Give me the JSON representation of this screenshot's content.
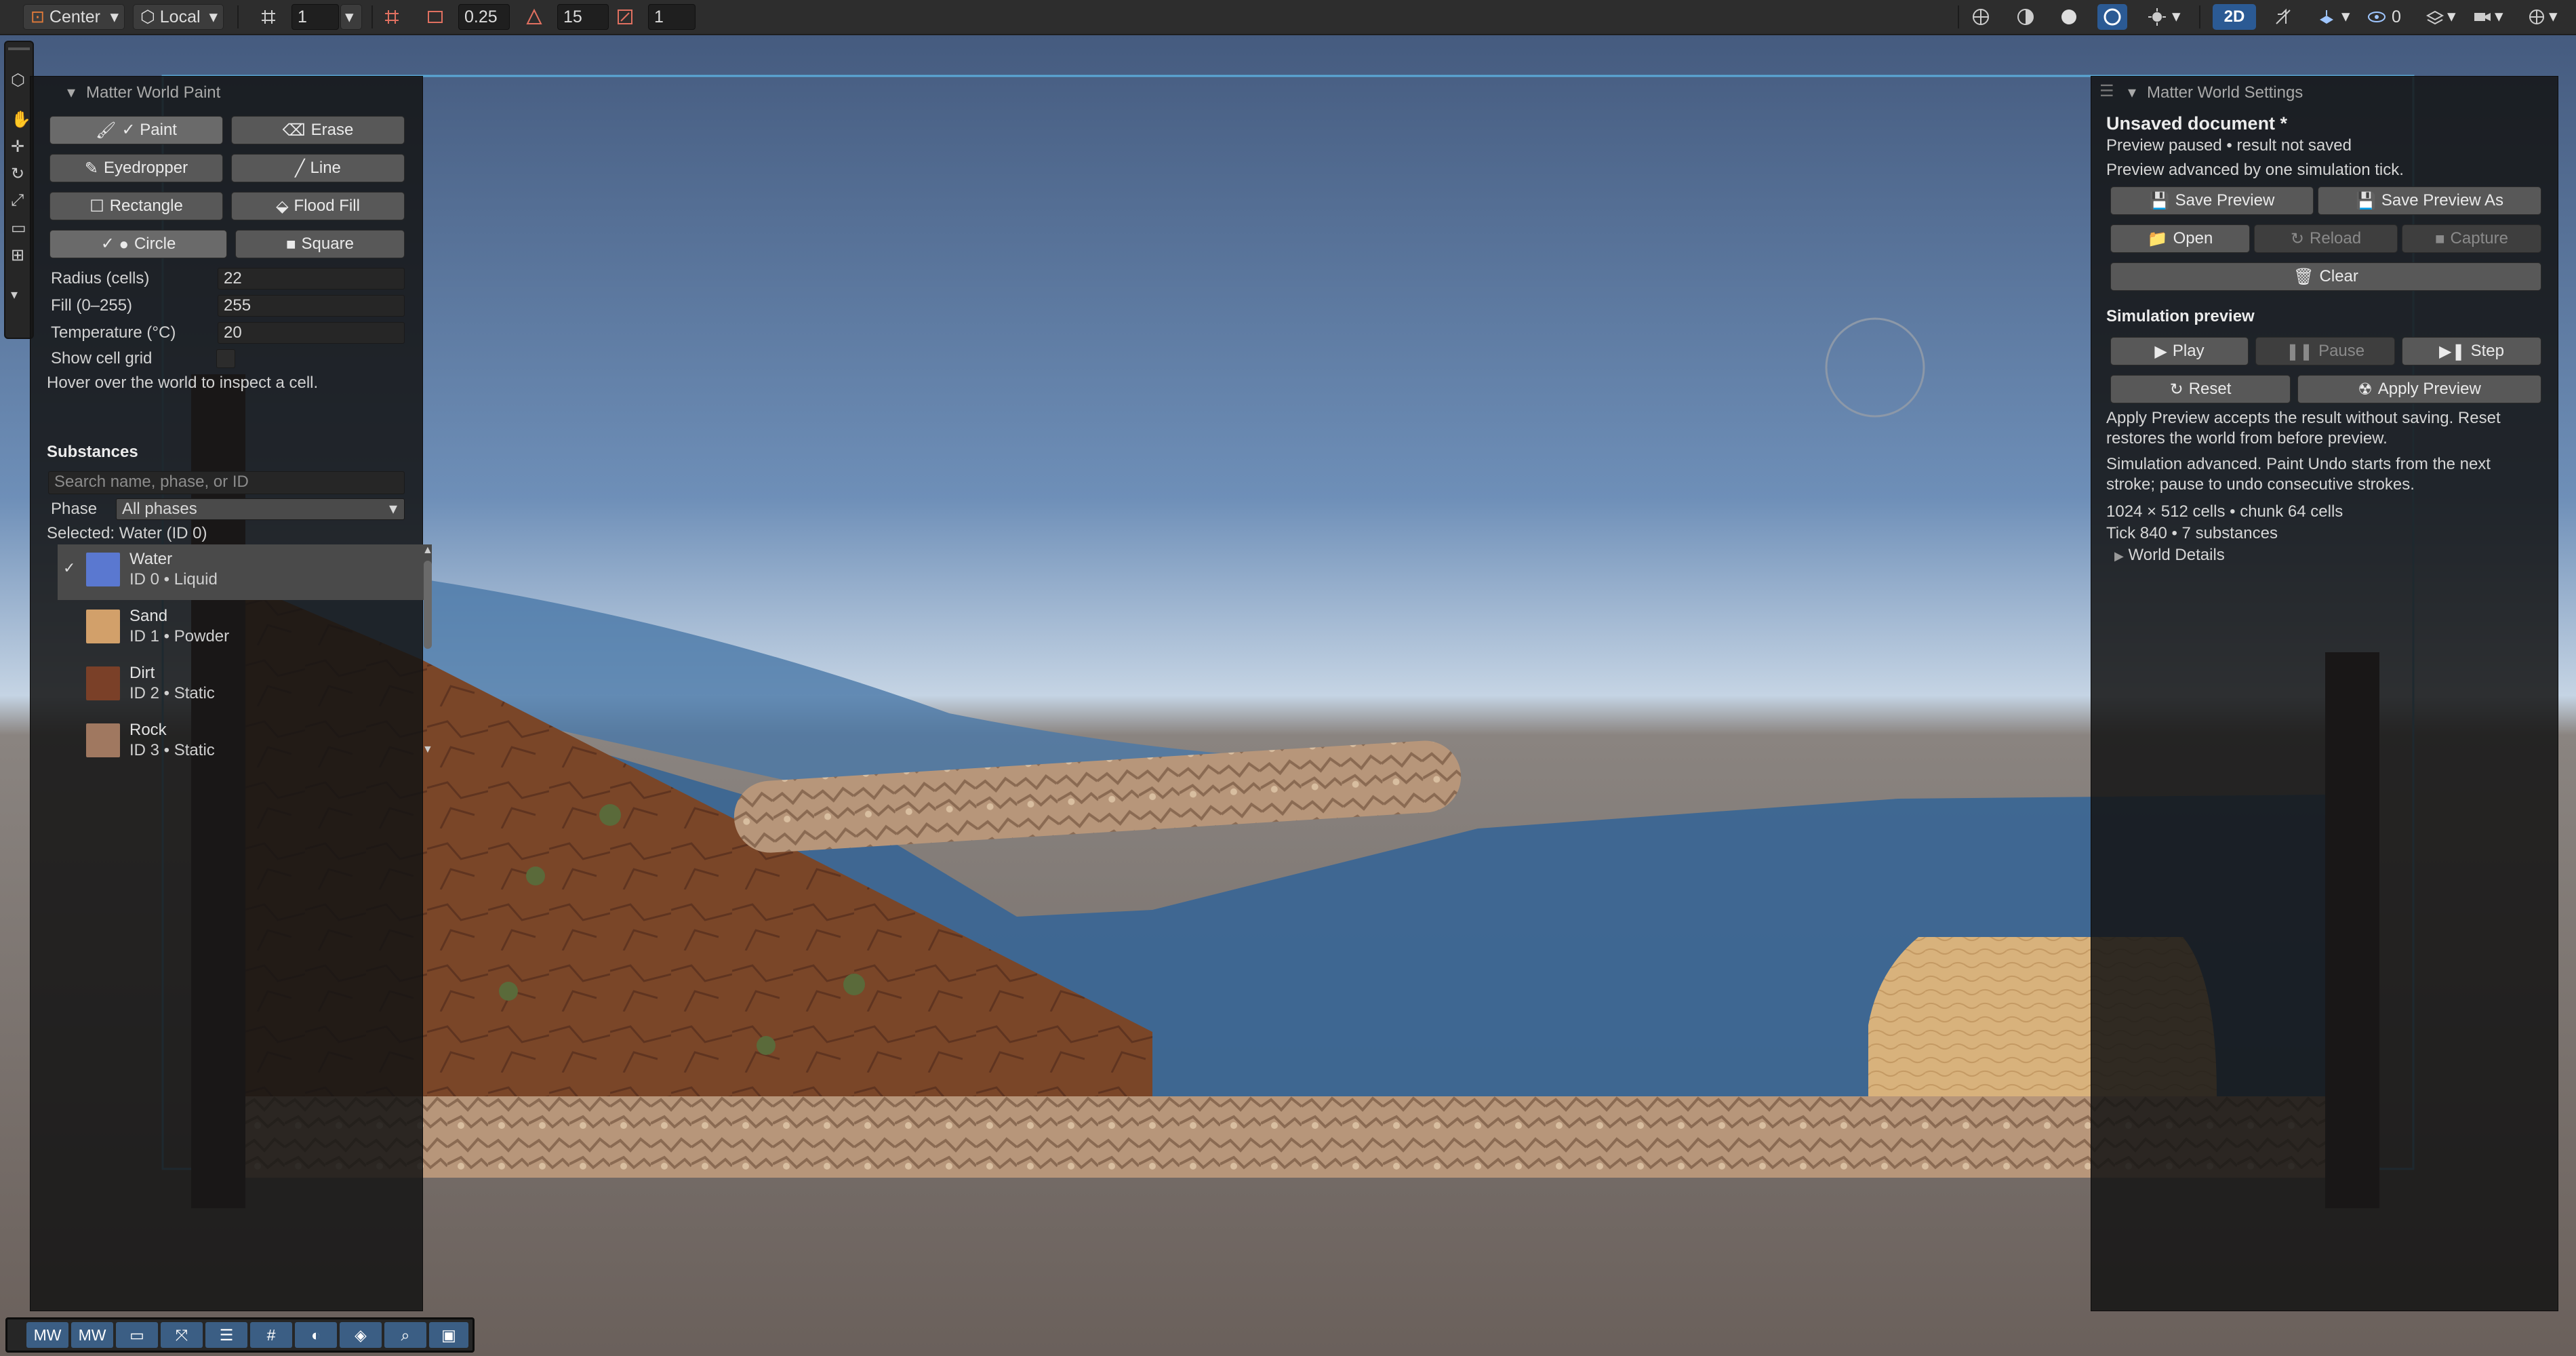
{
  "toolbar": {
    "pivot": "Center",
    "space": "Local",
    "grid_snap": "1",
    "snap_increment": "0.25",
    "rotate_snap": "15",
    "scale_snap": "1",
    "mode_2d": "2D",
    "visibility_count": "0"
  },
  "paint_panel": {
    "title": "Matter World Paint",
    "tools": {
      "paint": "Paint",
      "erase": "Erase",
      "eyedropper": "Eyedropper",
      "line": "Line",
      "rectangle": "Rectangle",
      "flood_fill": "Flood Fill",
      "circle": "Circle",
      "square": "Square"
    },
    "radius_label": "Radius (cells)",
    "radius_value": "22",
    "fill_label": "Fill (0–255)",
    "fill_value": "255",
    "temperature_label": "Temperature (°C)",
    "temperature_value": "20",
    "show_grid_label": "Show cell grid",
    "hover_hint": "Hover over the world to inspect a cell.",
    "substances_heading": "Substances",
    "search_placeholder": "Search name, phase, or ID",
    "phase_label": "Phase",
    "phase_value": "All phases",
    "selected_text": "Selected: Water (ID 0)",
    "substances": [
      {
        "name": "Water",
        "detail": "ID 0 • Liquid",
        "color": "#5a78d0"
      },
      {
        "name": "Sand",
        "detail": "ID 1 • Powder",
        "color": "#d2a06a"
      },
      {
        "name": "Dirt",
        "detail": "ID 2 • Static",
        "color": "#7a4028"
      },
      {
        "name": "Rock",
        "detail": "ID 3 • Static",
        "color": "#a07860"
      }
    ]
  },
  "settings_panel": {
    "title": "Matter World Settings",
    "doc_title": "Unsaved document *",
    "status_line": "Preview paused • result not saved",
    "status_line2": "Preview advanced by one simulation tick.",
    "save_preview": "Save Preview",
    "save_preview_as": "Save Preview As",
    "open": "Open",
    "reload": "Reload",
    "capture": "Capture",
    "clear": "Clear",
    "sim_heading": "Simulation preview",
    "play": "Play",
    "pause": "Pause",
    "step": "Step",
    "reset": "Reset",
    "apply_preview": "Apply Preview",
    "apply_note_1": "Apply Preview accepts the result without saving. Reset",
    "apply_note_2": "restores the world from before preview.",
    "sim_note_1": "Simulation advanced. Paint Undo starts from the next",
    "sim_note_2": "stroke; pause to undo consecutive strokes.",
    "world_size": "1024 × 512 cells • chunk 64 cells",
    "tick_info": "Tick 840 • 7 substances",
    "world_details": "World Details"
  },
  "bottom_bar": {
    "mw1": "MW",
    "mw2": "MW"
  },
  "colors": {
    "accent": "#2b5a94",
    "panel": "#141414",
    "button": "#585858"
  }
}
